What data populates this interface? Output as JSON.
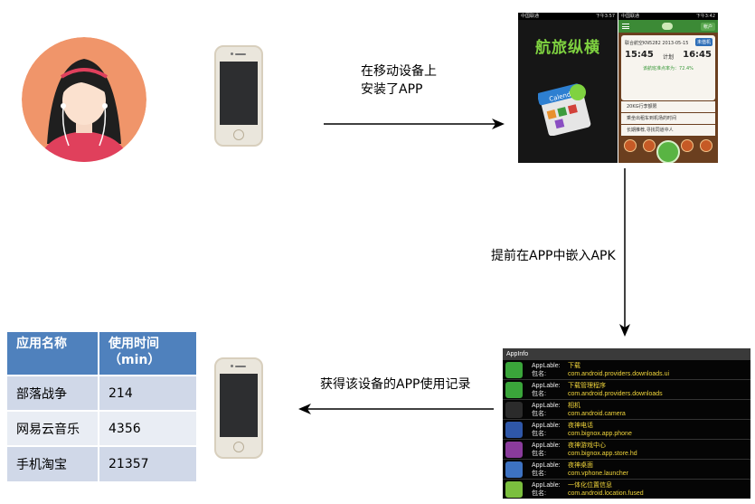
{
  "captions": {
    "install_line1": "在移动设备上",
    "install_line2": "安装了APP",
    "embed": "提前在APP中嵌入APK",
    "records": "获得该设备的APP使用记录"
  },
  "splash_app": {
    "status_left": "中国联通",
    "status_time": "下午3:57",
    "logo_text": "航旅纵横",
    "calendar_label": "Calendar"
  },
  "flight_app": {
    "status_left": "中国联通",
    "status_time": "下午3:42",
    "account_label": "帐户",
    "flight_tag": "未值机",
    "flight_no": "联合航空KN5282",
    "flight_date": "2013-05-15",
    "departure_time": "15:45",
    "plan_label": "计划",
    "arrival_time": "16:45",
    "on_time_rate": "该航班准点率为：72.4%",
    "info_lines": [
      "20KG行李额限",
      "乘坐出租车到机场的时间",
      "长期推荐,寻找同道中人"
    ]
  },
  "appinfo": {
    "title": "AppInfo",
    "label_app": "AppLable:",
    "label_pkg": "包名:",
    "items": [
      {
        "name": "下载",
        "package": "com.android.providers.downloads.ui",
        "icon": "download-icon",
        "color": "#3aa53a"
      },
      {
        "name": "下载管理程序",
        "package": "com.android.providers.downloads",
        "icon": "download-icon",
        "color": "#3aa53a"
      },
      {
        "name": "相机",
        "package": "com.android.camera",
        "icon": "camera-icon",
        "color": "#2b2b2b"
      },
      {
        "name": "夜神电话",
        "package": "com.bignox.app.phone",
        "icon": "phone-icon",
        "color": "#2f57a8"
      },
      {
        "name": "夜神游戏中心",
        "package": "com.bignox.app.store.hd",
        "icon": "nox-icon",
        "color": "#8a3b9c"
      },
      {
        "name": "夜神桌面",
        "package": "com.vphone.launcher",
        "icon": "nox-icon",
        "color": "#3d72c2"
      },
      {
        "name": "一体化位置信息",
        "package": "com.android.location.fused",
        "icon": "android-icon",
        "color": "#7bbf3e"
      }
    ]
  },
  "table": {
    "headers": [
      "应用名称",
      "使用时间",
      "（min）"
    ],
    "rows": [
      {
        "app": "部落战争",
        "minutes": "214"
      },
      {
        "app": "网易云音乐",
        "minutes": "4356"
      },
      {
        "app": "手机淘宝",
        "minutes": "21357"
      }
    ]
  },
  "colors": {
    "table_header": "#4f81bd",
    "row_dark": "#d0d8e8",
    "row_light": "#e9edf4",
    "avatar_bg": "#f0956a",
    "app_green": "#3c8a36",
    "appinfo_text": "#f0d43a"
  }
}
